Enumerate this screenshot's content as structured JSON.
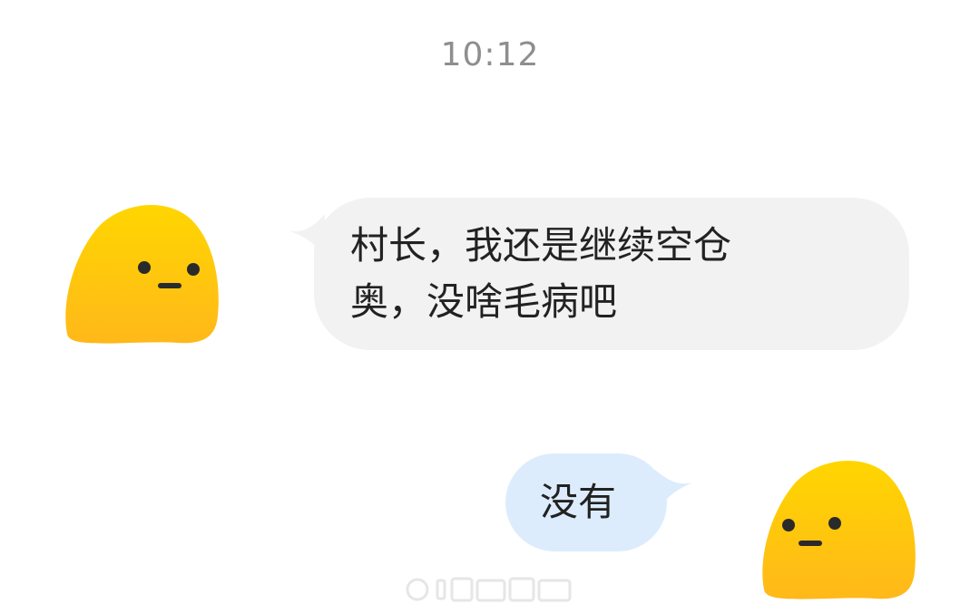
{
  "timestamp": "10:12",
  "messages": [
    {
      "direction": "incoming",
      "text": "村长，我还是继续空仓\n奥，没啥毛病吧",
      "line1": "村长，我还是继续空仓",
      "line2": "奥，没啥毛病吧",
      "bubble_color": "#f2f2f2",
      "avatar_icon": "yellow-blob-face-icon"
    },
    {
      "direction": "outgoing",
      "text": "没有",
      "bubble_color": "#dcecfc",
      "avatar_icon": "yellow-blob-face-icon"
    }
  ],
  "colors": {
    "avatar_top": "#ffd600",
    "avatar_bottom": "#ffb81a",
    "timestamp": "#8e8e8e",
    "text": "#222222"
  }
}
